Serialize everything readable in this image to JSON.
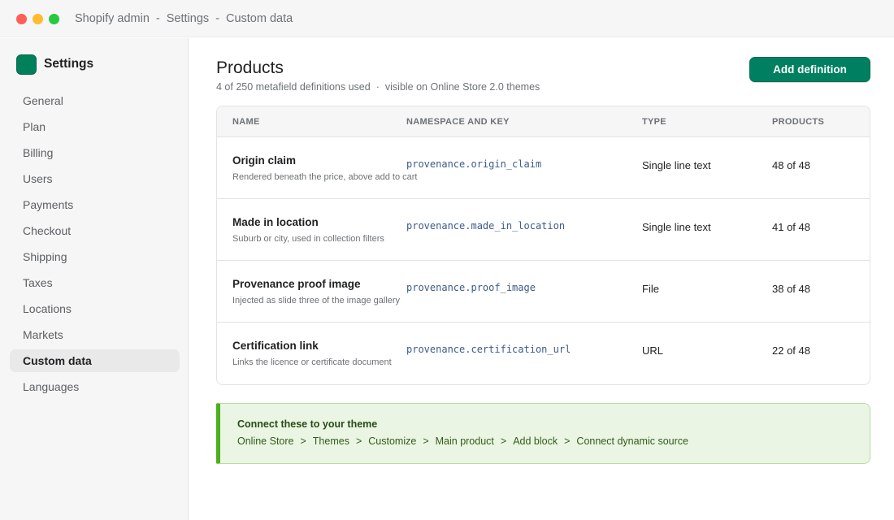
{
  "window": {
    "breadcrumb": [
      "Shopify admin",
      "Settings",
      "Custom data"
    ],
    "separator": "-"
  },
  "sidebar": {
    "title": "Settings",
    "items": [
      {
        "label": "General",
        "active": false
      },
      {
        "label": "Plan",
        "active": false
      },
      {
        "label": "Billing",
        "active": false
      },
      {
        "label": "Users",
        "active": false
      },
      {
        "label": "Payments",
        "active": false
      },
      {
        "label": "Checkout",
        "active": false
      },
      {
        "label": "Shipping",
        "active": false
      },
      {
        "label": "Taxes",
        "active": false
      },
      {
        "label": "Locations",
        "active": false
      },
      {
        "label": "Markets",
        "active": false
      },
      {
        "label": "Custom data",
        "active": true
      },
      {
        "label": "Languages",
        "active": false
      }
    ]
  },
  "page": {
    "title": "Products",
    "usage": "4 of 250 metafield definitions used",
    "dot": "·",
    "visibility": "visible on Online Store 2.0 themes",
    "add_button": "Add definition"
  },
  "table": {
    "headers": {
      "name": "NAME",
      "key": "NAMESPACE AND KEY",
      "type": "TYPE",
      "products": "PRODUCTS"
    },
    "rows": [
      {
        "name": "Origin claim",
        "description": "Rendered beneath the price, above add to cart",
        "key": "provenance.origin_claim",
        "type": "Single line text",
        "products": "48 of 48"
      },
      {
        "name": "Made in location",
        "description": "Suburb or city, used in collection filters",
        "key": "provenance.made_in_location",
        "type": "Single line text",
        "products": "41 of 48"
      },
      {
        "name": "Provenance proof image",
        "description": "Injected as slide three of the image gallery",
        "key": "provenance.proof_image",
        "type": "File",
        "products": "38 of 48"
      },
      {
        "name": "Certification link",
        "description": "Links the licence or certificate document",
        "key": "provenance.certification_url",
        "type": "URL",
        "products": "22 of 48"
      }
    ]
  },
  "banner": {
    "title": "Connect these to your theme",
    "separator": ">",
    "path": [
      "Online Store",
      "Themes",
      "Customize",
      "Main product",
      "Add block",
      "Connect dynamic source"
    ]
  },
  "colors": {
    "primary": "#008060",
    "brand_logo": "#00805a",
    "banner_accent": "#4caf1f",
    "banner_bg": "#ebf5e3"
  }
}
